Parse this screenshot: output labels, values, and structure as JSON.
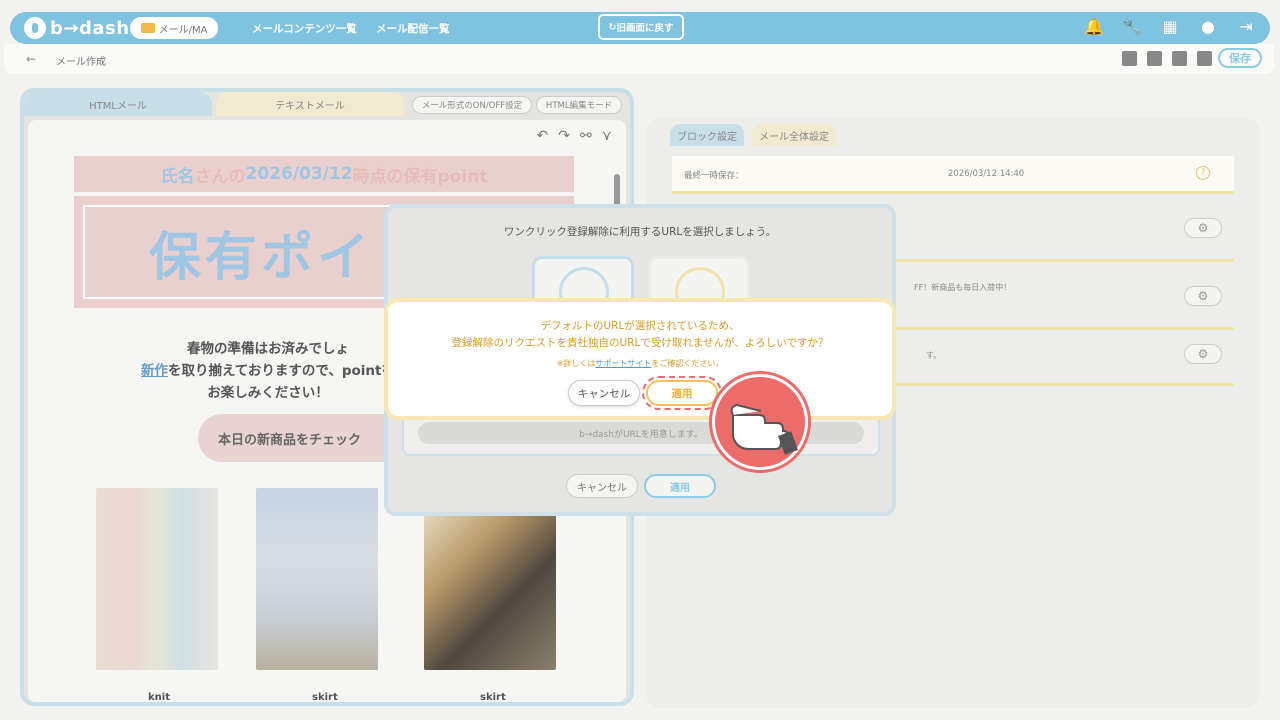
{
  "app": {
    "logo_text": "b→dash"
  },
  "topnav": {
    "mail_pill": "メール/MA",
    "links": [
      "メールコンテンツ一覧",
      "メール配信一覧"
    ],
    "back_old": "旧画面に戻す",
    "icons": [
      "bell-icon",
      "wrench-icon",
      "apps-grid-icon",
      "support-chat-icon",
      "logout-icon"
    ]
  },
  "subbar": {
    "back_arrow": "←",
    "page_title": "メール作成",
    "save_label": "保存"
  },
  "editor": {
    "tabs": {
      "html": "HTMLメール",
      "text": "テキストメール"
    },
    "mode_buttons": [
      "メール形式のON/OFF設定",
      "HTML編集モード"
    ],
    "tools": {
      "undo": "↶",
      "redo": "↷",
      "link": "⚯",
      "merge": "⋎"
    },
    "header_parts": [
      "氏名",
      "さんの",
      "2026/03/12",
      "時点の保有point"
    ],
    "banner_text": "保有ポイ",
    "body_line1": "春物の準備はお済みでしょ",
    "body_link": "新作",
    "body_line2_rest": "を取り揃えておりますので、pointを",
    "body_line3": "お楽しみください！",
    "cta": "本日の新商品をチェック",
    "captions": [
      "knit",
      "skirt",
      "skirt"
    ]
  },
  "right_panel": {
    "tabs": {
      "block": "ブロック設定",
      "mail": "メール全体設定"
    },
    "last_saved_label": "最終一時保存：",
    "last_saved_value": "2026/03/12 14:40",
    "help": "?",
    "row_texts": [
      "",
      "FF！新商品も毎日入荷中！",
      "す。"
    ]
  },
  "modal_back": {
    "title": "ワンクリック登録解除に利用するURLを選択しましょう。",
    "url_placeholder": "b→dashがURLを用意します。",
    "cancel": "キャンセル",
    "apply": "適用"
  },
  "confirm": {
    "line1": "デフォルトのURLが選択されているため、",
    "line2": "登録解除のリクエストを貴社独自のURLで受け取れませんが、よろしいですか？",
    "note_prefix": "※詳しくは",
    "note_link": "サポートサイト",
    "note_suffix": "をご確認ください。",
    "cancel": "キャンセル",
    "apply": "適用"
  },
  "colors": {
    "accent_blue": "#7fc3e0",
    "confirm_text": "#d69b26",
    "apply_border": "#f2c35a",
    "pointer": "#ec6b6b"
  }
}
